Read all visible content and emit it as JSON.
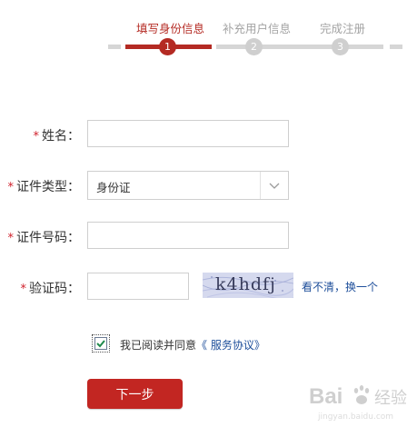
{
  "steps": [
    {
      "label": "填写身份信息",
      "number": "1",
      "active": true
    },
    {
      "label": "补充用户信息",
      "number": "2",
      "active": false
    },
    {
      "label": "完成注册",
      "number": "3",
      "active": false
    }
  ],
  "form": {
    "required_mark": "*",
    "name": {
      "label": "姓名：",
      "value": ""
    },
    "id_type": {
      "label": "证件类型：",
      "value": "身份证"
    },
    "id_number": {
      "label": "证件号码：",
      "value": ""
    },
    "captcha": {
      "label": "验证码：",
      "value": "",
      "image_text": "k4hdfj",
      "refresh_label": "看不清，换一个"
    }
  },
  "agreement": {
    "checked": true,
    "text": "我已阅读并同意",
    "link_text": "《 服务协议》"
  },
  "next_button": {
    "label": "下一步"
  },
  "watermark": {
    "logo_text": "Bai",
    "logo_text2": "经验",
    "sub_text": "jingyan.baidu.com"
  },
  "colors": {
    "accent": "#b42a23",
    "button": "#c22622",
    "link": "#1d4e9a",
    "required": "#d0202b"
  }
}
